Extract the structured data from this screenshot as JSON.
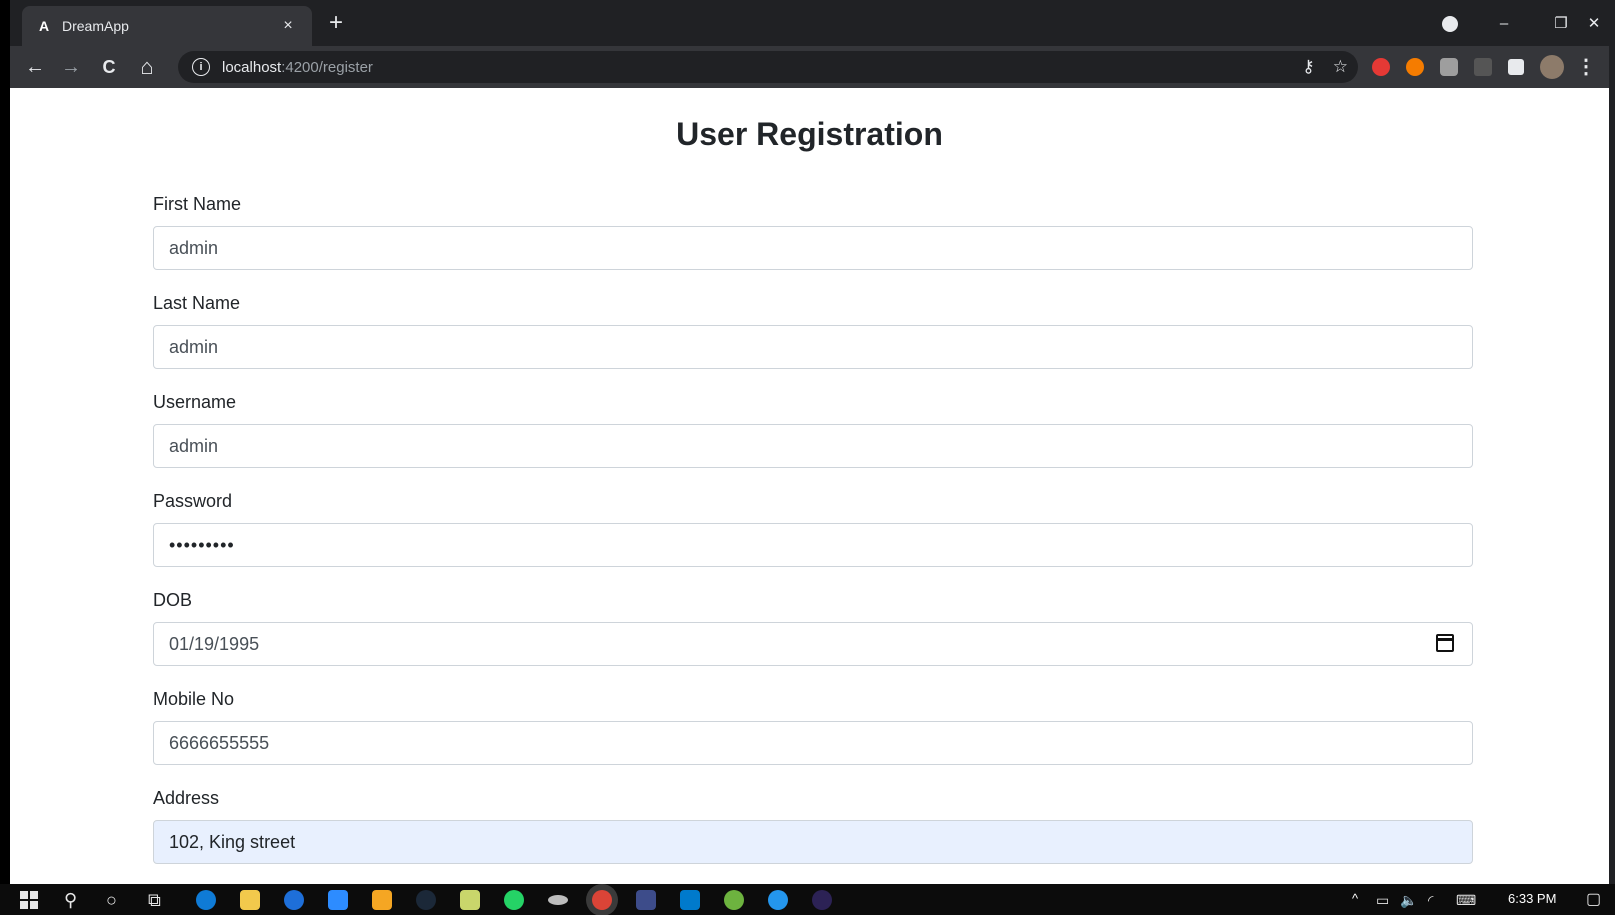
{
  "browser": {
    "tab": {
      "favicon": "A",
      "title": "DreamApp",
      "close": "×"
    },
    "new_tab": "+",
    "window_controls": {
      "minimize": "–",
      "restore": "❐",
      "close": "✕"
    },
    "nav": {
      "back": "←",
      "forward": "→",
      "reload": "C",
      "home": "⌂"
    },
    "address": {
      "host": "localhost",
      "rest": ":4200/register",
      "info": "i"
    },
    "omnibox_icons": {
      "key": "⚷",
      "star": "☆"
    }
  },
  "page": {
    "title": "User Registration",
    "fields": [
      {
        "label": "First Name",
        "value": "admin"
      },
      {
        "label": "Last Name",
        "value": "admin"
      },
      {
        "label": "Username",
        "value": "admin"
      },
      {
        "label": "Password",
        "value": "•••••••••"
      },
      {
        "label": "DOB",
        "value": "01/19/1995"
      },
      {
        "label": "Mobile No",
        "value": "6666655555"
      },
      {
        "label": "Address",
        "value": "102, King street"
      }
    ]
  },
  "taskbar": {
    "tray": {
      "time": "6:33 PM",
      "chevron": "^"
    }
  }
}
